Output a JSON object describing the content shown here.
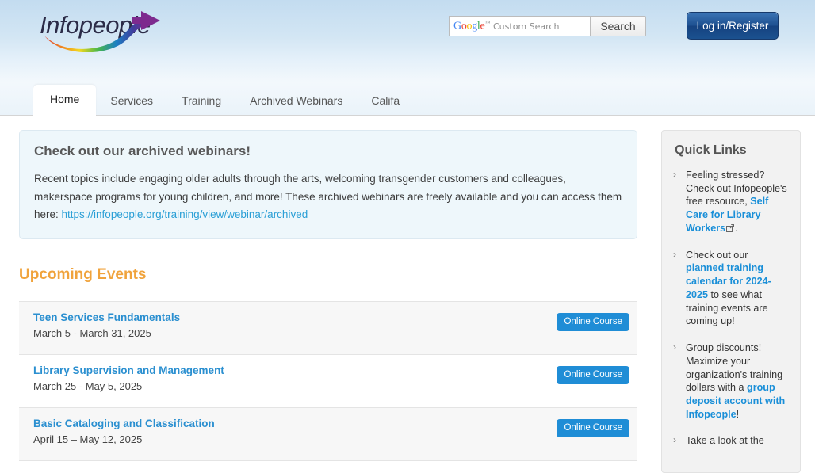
{
  "header": {
    "logo_text": "Infopeople",
    "search": {
      "google_word": "Google",
      "tm": "™",
      "placeholder": "Custom Search",
      "value": "",
      "button_label": "Search"
    },
    "login_label": "Log in/Register"
  },
  "nav": {
    "tabs": [
      {
        "label": "Home",
        "active": true
      },
      {
        "label": "Services",
        "active": false
      },
      {
        "label": "Training",
        "active": false
      },
      {
        "label": "Archived Webinars",
        "active": false
      },
      {
        "label": "Califa",
        "active": false
      }
    ]
  },
  "notice": {
    "heading": "Check out our archived webinars!",
    "body_before_link": "Recent topics include engaging older adults through the arts, welcoming transgender customers and colleagues, makerspace programs for young children, and more! These archived webinars are freely available and you can access them here: ",
    "link_text": "https://infopeople.org/training/view/webinar/archived"
  },
  "events_section": {
    "title": "Upcoming Events",
    "badge_label": "Online Course",
    "items": [
      {
        "title": "Teen Services Fundamentals",
        "dates": "March 5 - March 31, 2025",
        "badge": "Online Course"
      },
      {
        "title": "Library Supervision and Management",
        "dates": "March 25 - May 5, 2025",
        "badge": "Online Course"
      },
      {
        "title": "Basic Cataloging and Classification",
        "dates": "April 15 – May 12, 2025",
        "badge": "Online Course"
      }
    ]
  },
  "sidebar": {
    "title": "Quick Links",
    "items": [
      {
        "pre": "Feeling stressed? Check out Infopeople's free resource, ",
        "link": "Self Care for Library Workers",
        "has_ext_icon": true,
        "post": "."
      },
      {
        "pre": "Check out our ",
        "link": "planned training calendar for 2024-2025",
        "has_ext_icon": false,
        "post": " to see what training events are coming up!"
      },
      {
        "pre": "Group discounts! Maximize your organization's training dollars with a ",
        "link": "group deposit account with Infopeople",
        "has_ext_icon": false,
        "post": "!"
      },
      {
        "pre": "Take a look at the",
        "link": "",
        "has_ext_icon": false,
        "post": ""
      }
    ]
  },
  "colors": {
    "header_gradient_top": "#c3dcf0",
    "brand_blue": "#1f8dd6",
    "accent_orange": "#f0a33c",
    "login_blue": "#1d4f8f",
    "panel_gray": "#f2f2f2"
  }
}
